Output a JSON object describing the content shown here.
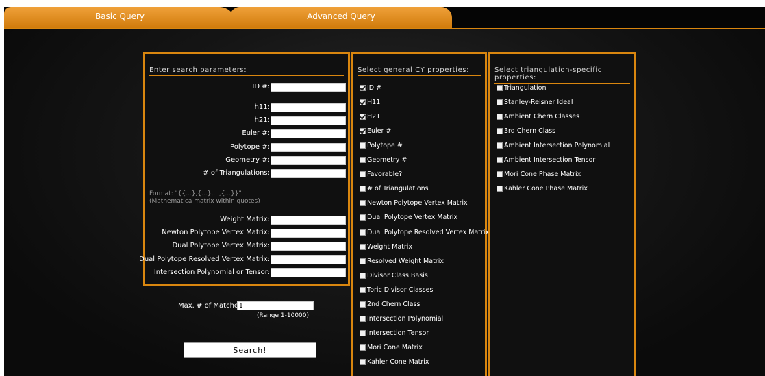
{
  "tabs": {
    "basic": "Basic Query",
    "advanced": "Advanced Query"
  },
  "search_panel": {
    "title": "Enter search parameters:",
    "fields1": [
      {
        "label": "ID #:",
        "value": ""
      }
    ],
    "fields2": [
      {
        "label": "h11:",
        "value": ""
      },
      {
        "label": "h21:",
        "value": ""
      },
      {
        "label": "Euler #:",
        "value": ""
      },
      {
        "label": "Polytope #:",
        "value": ""
      },
      {
        "label": "Geometry #:",
        "value": ""
      },
      {
        "label": "# of Triangulations:",
        "value": ""
      }
    ],
    "format_line1": "Format: \"{{...},{...},...,{...}}\"",
    "format_line2": "(Mathematica matrix within quotes)",
    "fields3": [
      {
        "label": "Weight Matrix:",
        "value": ""
      },
      {
        "label": "Newton Polytope Vertex Matrix:",
        "value": ""
      },
      {
        "label": "Dual Polytope Vertex Matrix:",
        "value": ""
      },
      {
        "label": "Dual Polytope Resolved Vertex Matrix:",
        "value": ""
      },
      {
        "label": "Intersection Polynomial or Tensor:",
        "value": ""
      }
    ]
  },
  "max_matches": {
    "label": "Max. # of Matches:",
    "value": "1",
    "range": "(Range 1-10000)"
  },
  "search_button": "Search!",
  "cy_panel": {
    "title": "Select general CY properties:",
    "items": [
      {
        "label": "ID #",
        "checked": true
      },
      {
        "label": "H11",
        "checked": true
      },
      {
        "label": "H21",
        "checked": true
      },
      {
        "label": "Euler #",
        "checked": true
      },
      {
        "label": "Polytope #",
        "checked": false
      },
      {
        "label": "Geometry #",
        "checked": false
      },
      {
        "label": "Favorable?",
        "checked": false
      },
      {
        "label": "# of Triangulations",
        "checked": false
      },
      {
        "label": "Newton Polytope Vertex Matrix",
        "checked": false
      },
      {
        "label": "Dual Polytope Vertex Matrix",
        "checked": false
      },
      {
        "label": "Dual Polytope Resolved Vertex Matrix",
        "checked": false
      },
      {
        "label": "Weight Matrix",
        "checked": false
      },
      {
        "label": "Resolved Weight Matrix",
        "checked": false
      },
      {
        "label": "Divisor Class Basis",
        "checked": false
      },
      {
        "label": "Toric Divisor Classes",
        "checked": false
      },
      {
        "label": "2nd Chern Class",
        "checked": false
      },
      {
        "label": "Intersection Polynomial",
        "checked": false
      },
      {
        "label": "Intersection Tensor",
        "checked": false
      },
      {
        "label": "Mori Cone Matrix",
        "checked": false
      },
      {
        "label": "Kahler Cone Matrix",
        "checked": false
      }
    ]
  },
  "tri_panel": {
    "title": "Select triangulation-specific properties:",
    "items": [
      {
        "label": "Triangulation",
        "checked": false
      },
      {
        "label": "Stanley-Reisner Ideal",
        "checked": false
      },
      {
        "label": "Ambient Chern Classes",
        "checked": false
      },
      {
        "label": "3rd Chern Class",
        "checked": false
      },
      {
        "label": "Ambient Intersection Polynomial",
        "checked": false
      },
      {
        "label": "Ambient Intersection Tensor",
        "checked": false
      },
      {
        "label": "Mori Cone Phase Matrix",
        "checked": false
      },
      {
        "label": "Kahler Cone Phase Matrix",
        "checked": false
      }
    ]
  },
  "colors": {
    "accent": "#d9860f",
    "background": "#0b0b0b"
  }
}
